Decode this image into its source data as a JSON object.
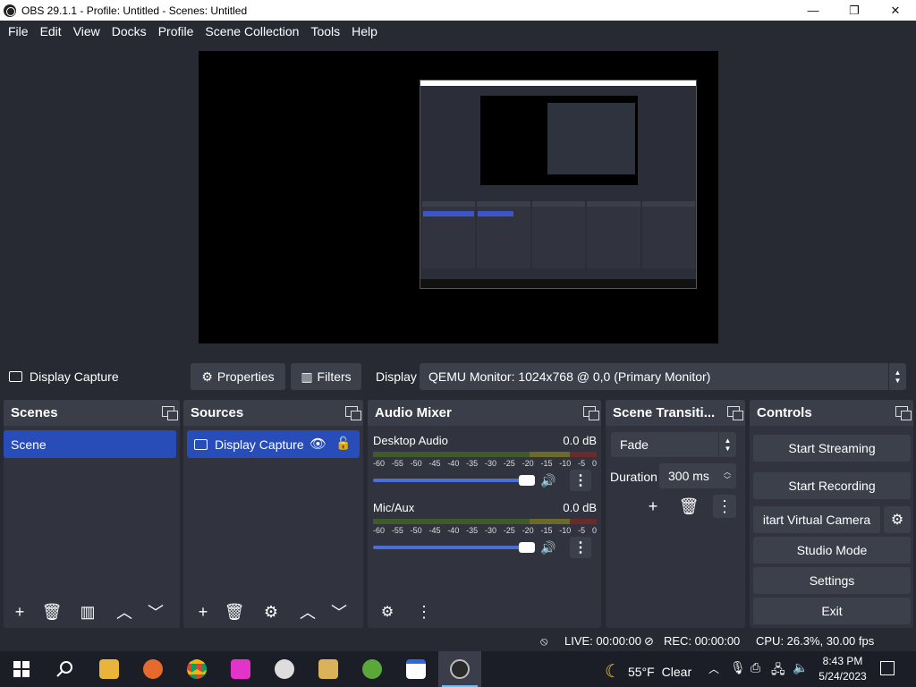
{
  "window": {
    "title": "OBS 29.1.1 - Profile: Untitled - Scenes: Untitled",
    "minimize": "—",
    "maximize": "❐",
    "close": "✕"
  },
  "menu": [
    "File",
    "Edit",
    "View",
    "Docks",
    "Profile",
    "Scene Collection",
    "Tools",
    "Help"
  ],
  "source_toolbar": {
    "source_name": "Display Capture",
    "properties_label": "Properties",
    "filters_label": "Filters",
    "display_label": "Display",
    "display_value": "QEMU Monitor: 1024x768 @ 0,0 (Primary Monitor)"
  },
  "scenes": {
    "title": "Scenes",
    "items": [
      "Scene"
    ]
  },
  "sources": {
    "title": "Sources",
    "items": [
      "Display Capture"
    ]
  },
  "audio_mixer": {
    "title": "Audio Mixer",
    "channels": [
      {
        "name": "Desktop Audio",
        "db": "0.0 dB"
      },
      {
        "name": "Mic/Aux",
        "db": "0.0 dB"
      }
    ],
    "ticks": [
      "-60",
      "-55",
      "-50",
      "-45",
      "-40",
      "-35",
      "-30",
      "-25",
      "-20",
      "-15",
      "-10",
      "-5",
      "0"
    ]
  },
  "transitions": {
    "title": "Scene Transiti...",
    "selected": "Fade",
    "duration_label": "Duration",
    "duration_value": "300 ms"
  },
  "controls": {
    "title": "Controls",
    "start_streaming": "Start Streaming",
    "start_recording": "Start Recording",
    "start_virtual_camera": "itart Virtual Camera",
    "studio_mode": "Studio Mode",
    "settings": "Settings",
    "exit": "Exit"
  },
  "status": {
    "live": "LIVE: 00:00:00",
    "rec": "REC: 00:00:00",
    "cpu": "CPU: 26.3%, 30.00 fps"
  },
  "taskbar": {
    "weather_temp": "55°F",
    "weather_text": "Clear",
    "time": "8:43 PM",
    "date": "5/24/2023"
  },
  "colors": {
    "accent": "#284cb8",
    "panel": "#31343e",
    "background": "#272a33",
    "button": "#3c404b"
  }
}
